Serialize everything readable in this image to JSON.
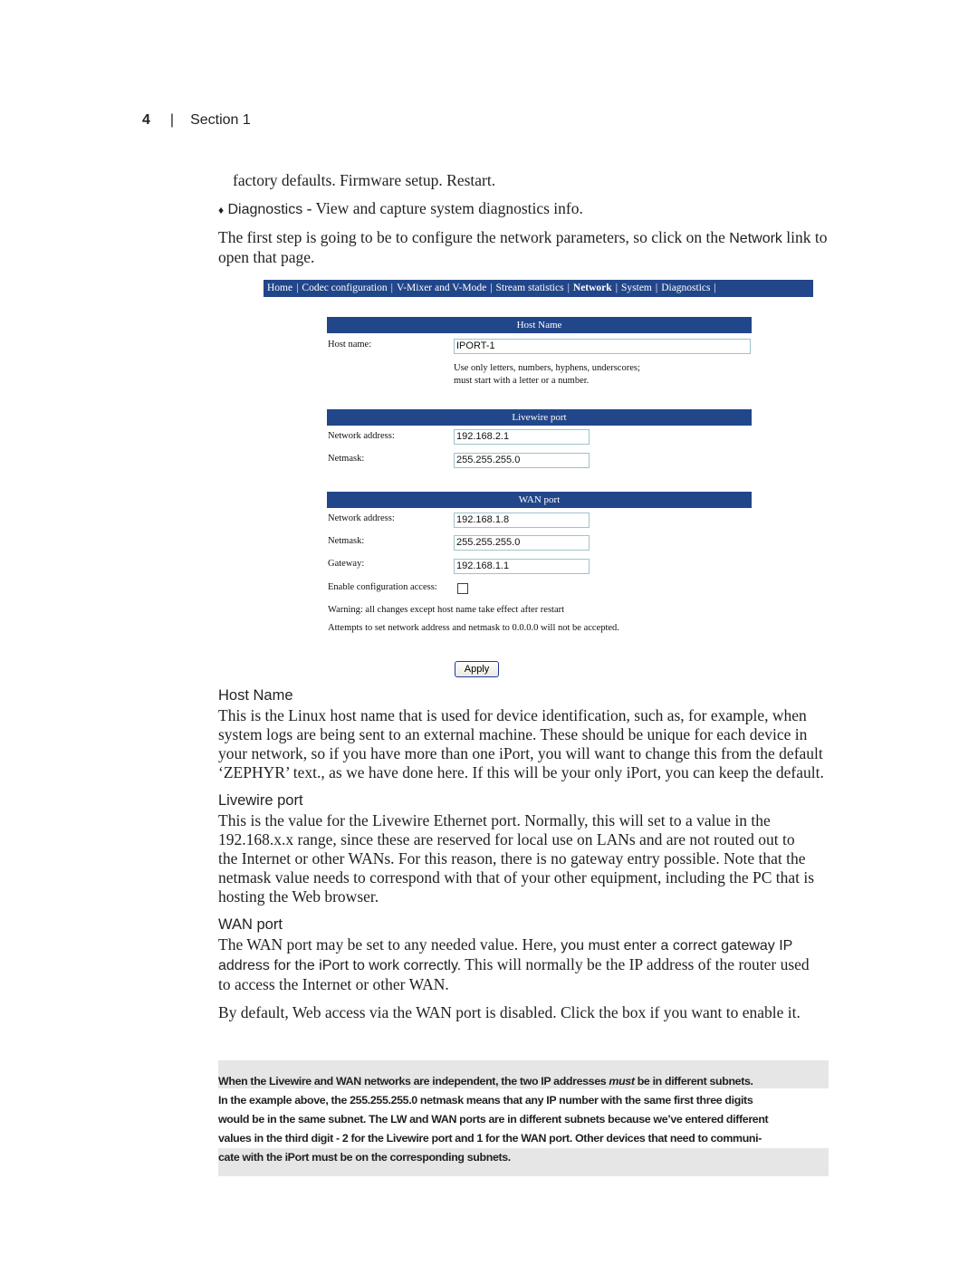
{
  "page_header": {
    "page_number": "4",
    "separator": "|",
    "section": "Section 1"
  },
  "intro": {
    "continued_line": "factory defaults. Firmware setup. Restart.",
    "bullet_glyph": "♦",
    "bullet_term": "Diagnostics",
    "bullet_text": " - View and capture system diagnostics info.",
    "step_text_before": "The first step is going to be to configure the network parameters, so click on the ",
    "step_link": "Network",
    "step_text_after": " link to open that page."
  },
  "web_ui": {
    "nav": {
      "separator": "|",
      "items": [
        {
          "label": "Home",
          "active": false
        },
        {
          "label": "Codec configuration",
          "active": false
        },
        {
          "label": "V-Mixer and V-Mode",
          "active": false
        },
        {
          "label": "Stream statistics",
          "active": false
        },
        {
          "label": "Network",
          "active": true
        },
        {
          "label": "System",
          "active": false
        },
        {
          "label": "Diagnostics",
          "active": false
        }
      ]
    },
    "host_name_section": {
      "title": "Host Name",
      "label": "Host name:",
      "value": "IPORT-1",
      "hint_line1": "Use only letters, numbers, hyphens, underscores;",
      "hint_line2": "must start with a letter or a number."
    },
    "livewire_section": {
      "title": "Livewire port",
      "address_label": "Network address:",
      "address_value": "192.168.2.1",
      "netmask_label": "Netmask:",
      "netmask_value": "255.255.255.0"
    },
    "wan_section": {
      "title": "WAN port",
      "address_label": "Network address:",
      "address_value": "192.168.1.8",
      "netmask_label": "Netmask:",
      "netmask_value": "255.255.255.0",
      "gateway_label": "Gateway:",
      "gateway_value": "192.168.1.1",
      "enable_label": "Enable configuration access:",
      "enable_checked": false
    },
    "warning": "Warning: all changes except host name take effect after restart",
    "zero_note": "Attempts to set network address and netmask to 0.0.0.0 will not be accepted.",
    "apply_label": "Apply",
    "colors": {
      "header_bar": "#22468a",
      "input_border": "#9cc3cc"
    }
  },
  "sections": {
    "host_name": {
      "heading": "Host Name",
      "lines": [
        "This is the Linux host name that is used for device identification, such as, for example, when",
        "system logs are being sent to an external machine. These should be unique for each device in",
        "your network, so if you have more than one iPort, you will want to change this from the default",
        "‘ZEPHYR’ text., as we have done here. If this will be your only iPort, you can keep the default."
      ]
    },
    "livewire_port": {
      "heading": "Livewire port",
      "lines": [
        "This is the value for the Livewire Ethernet port. Normally, this will set to a value in the",
        "192.168.x.x range, since these are reserved for local use on LANs and are not routed out to",
        "the Internet or other WANs. For this reason, there is no gateway entry possible. Note that the",
        "netmask value needs to correspond with that of your other equipment, including the PC that is",
        "hosting the Web browser."
      ]
    },
    "wan_port": {
      "heading": "WAN port",
      "line1_serif": "The WAN port may be set to any needed value. Here, ",
      "line1_sans": "you must enter a correct gateway IP",
      "line2_sans": "address for the iPort to work correctly.",
      "line2_serif": " This will normally be the IP address of the router used",
      "line3": "to access the Internet or other WAN.",
      "default_note": "By default, Web access via the WAN port is disabled. Click the box if you want to enable it."
    }
  },
  "note_box": {
    "line1_before": "When the Livewire and WAN networks are independent, the two IP addresses ",
    "line1_emph": "must",
    "line1_after": " be in different subnets.",
    "lines": [
      "In the example above, the 255.255.255.0 netmask means that any IP number with the same first three digits",
      "would be in the same subnet. The LW and WAN ports are in different subnets because we’ve entered different",
      "values in the third digit - 2 for the Livewire port and 1 for the WAN port.  Other devices that need to communi-",
      "cate with the iPort must be on the corresponding subnets."
    ],
    "background": "#e6e6e6"
  }
}
